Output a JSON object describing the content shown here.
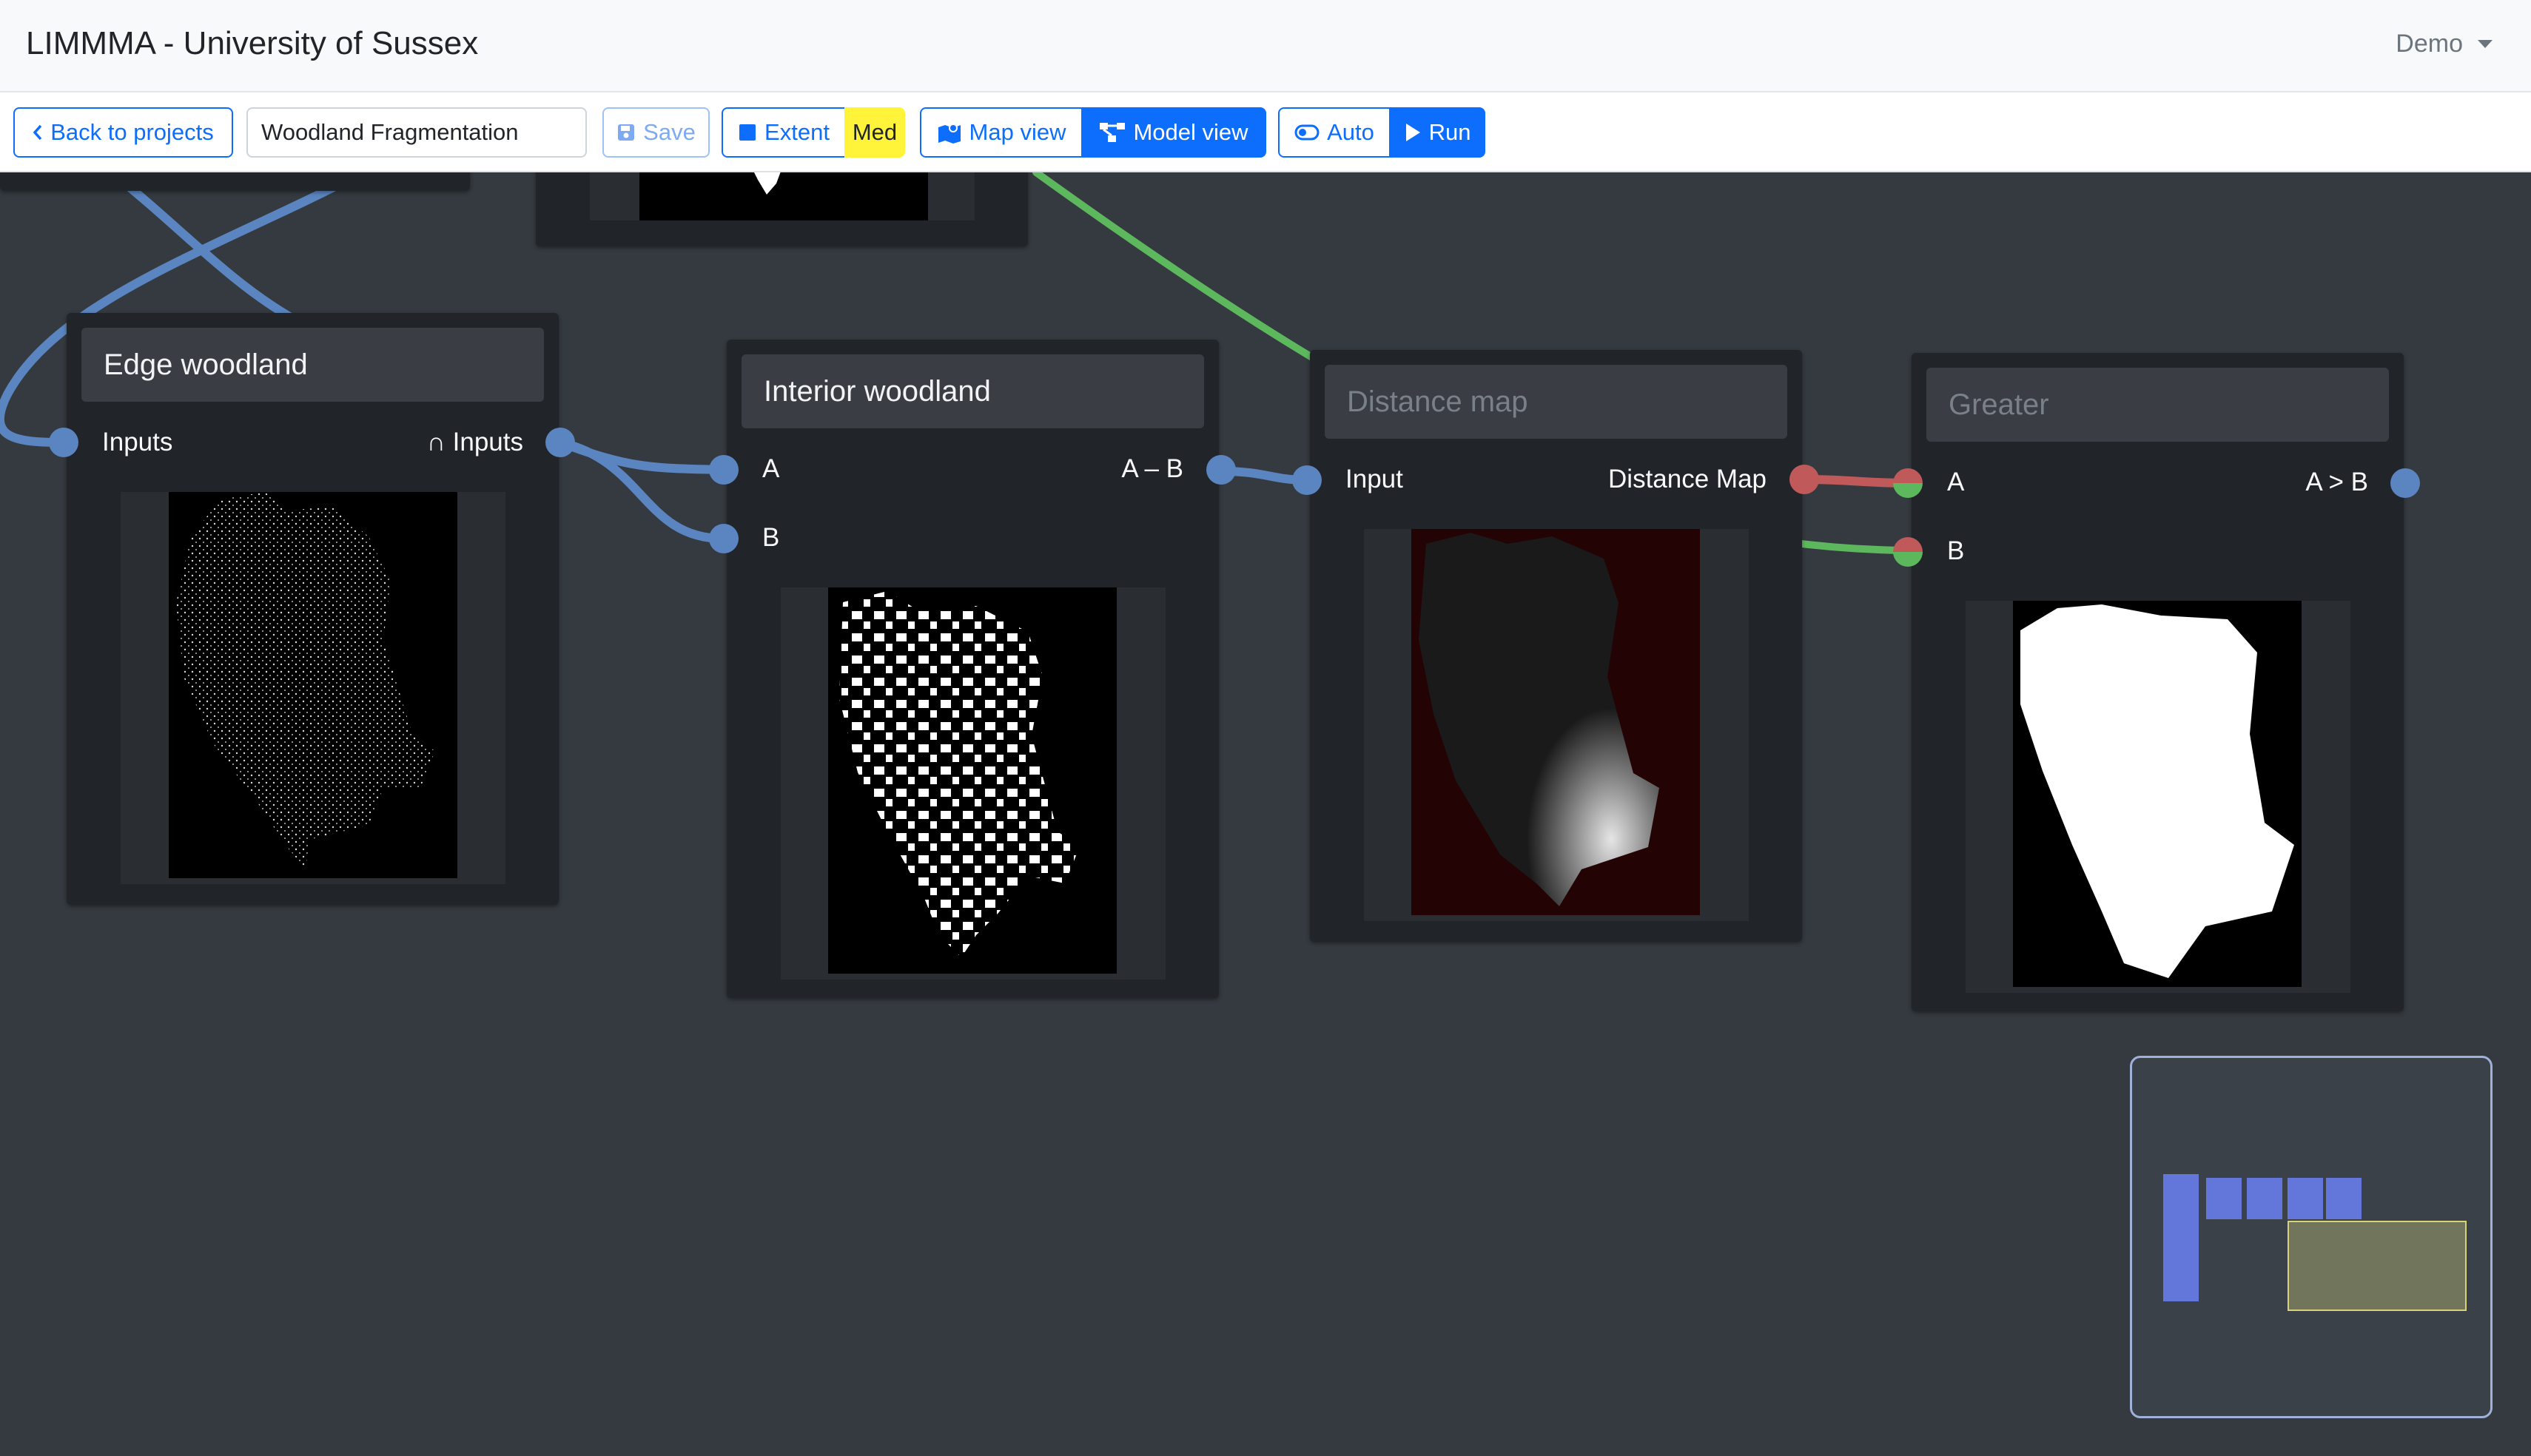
{
  "app": {
    "title": "LIMMMA - University of Sussex",
    "user_menu": "Demo"
  },
  "toolbar": {
    "back_label": "Back to projects",
    "project_name": "Woodland Fragmentation",
    "save_label": "Save",
    "extent_label": "Extent",
    "extent_badge": "Med",
    "map_view_label": "Map view",
    "model_view_label": "Model view",
    "auto_label": "Auto",
    "run_label": "Run",
    "active_view": "Model view"
  },
  "nodes": {
    "edge_woodland": {
      "title": "Edge woodland",
      "input_label": "Inputs",
      "output_label": "∩ Inputs"
    },
    "interior_woodland": {
      "title": "Interior woodland",
      "input_a": "A",
      "input_b": "B",
      "output_label": "A – B"
    },
    "distance_map": {
      "title": "Distance map",
      "input_label": "Input",
      "output_label": "Distance Map"
    },
    "greater": {
      "title": "Greater",
      "input_a": "A",
      "input_b": "B",
      "output_label": "A > B"
    }
  },
  "colors": {
    "wire_blue": "#5a85c0",
    "wire_green": "#5db85d",
    "wire_red": "#c05a5a",
    "accent": "#0d6efd",
    "extent_badge": "#fff43a"
  }
}
